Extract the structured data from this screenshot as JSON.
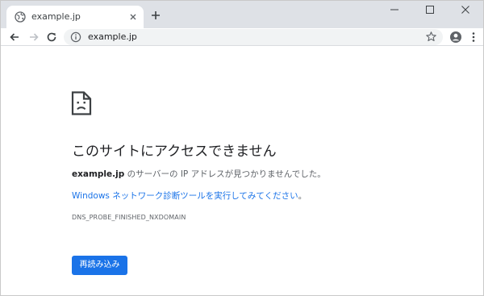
{
  "tab": {
    "title": "example.jp",
    "favicon": "globe-icon"
  },
  "toolbar": {
    "url": "example.jp"
  },
  "error": {
    "heading": "このサイトにアクセスできません",
    "host": "example.jp",
    "message_suffix": " のサーバーの IP アドレスが見つかりませんでした。",
    "diagnostics_link": "Windows ネットワーク診断ツールを実行してみてください",
    "diagnostics_period": "。",
    "code": "DNS_PROBE_FINISHED_NXDOMAIN",
    "reload_label": "再読み込み"
  },
  "colors": {
    "accent": "#1a73e8",
    "tabstrip": "#dee1e6",
    "omnibox": "#f1f3f4"
  }
}
